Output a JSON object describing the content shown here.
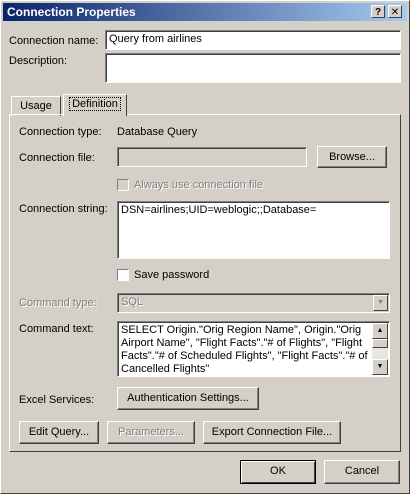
{
  "window": {
    "title": "Connection Properties",
    "help_button": "?",
    "close_button": "✕"
  },
  "connection_name": {
    "label": "Connection name:",
    "value": "Query from airlines"
  },
  "description": {
    "label": "Description:",
    "value": ""
  },
  "tabs": [
    {
      "label": "Usage",
      "active": false
    },
    {
      "label": "Definition",
      "active": true
    }
  ],
  "definition": {
    "connection_type": {
      "label": "Connection type:",
      "value": "Database Query"
    },
    "connection_file": {
      "label": "Connection file:",
      "value": "",
      "browse_label": "Browse..."
    },
    "always_use": {
      "label": "Always use connection file",
      "checked": false
    },
    "connection_string": {
      "label": "Connection string:",
      "value": "DSN=airlines;UID=weblogic;;Database="
    },
    "save_password": {
      "label": "Save password",
      "checked": false
    },
    "command_type": {
      "label": "Command type:",
      "value": "SQL"
    },
    "command_text": {
      "label": "Command text:",
      "value": "SELECT Origin.\"Orig Region Name\", Origin.\"Orig Airport Name\", \"Flight Facts\".\"# of Flights\", \"Flight Facts\".\"# of Scheduled Flights\", \"Flight Facts\".\"# of Cancelled Flights\""
    },
    "excel_services": {
      "label": "Excel Services:",
      "auth_button": "Authentication Settings..."
    },
    "buttons": {
      "edit_query": "Edit Query...",
      "parameters": "Parameters...",
      "export": "Export Connection File..."
    }
  },
  "footer": {
    "ok": "OK",
    "cancel": "Cancel"
  }
}
